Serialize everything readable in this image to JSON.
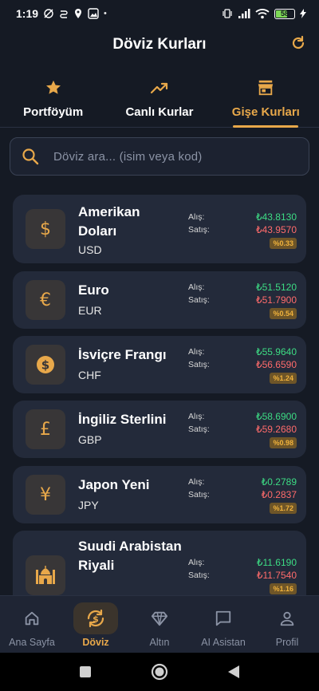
{
  "status_bar": {
    "time": "1:19",
    "battery": "58",
    "dot": "•"
  },
  "header": {
    "title": "Döviz Kurları"
  },
  "tabs": [
    {
      "label": "Portföyüm",
      "icon": "star-icon",
      "active": false
    },
    {
      "label": "Canlı Kurlar",
      "icon": "trending-up-icon",
      "active": false
    },
    {
      "label": "Gişe Kurları",
      "icon": "store-icon",
      "active": true
    }
  ],
  "search": {
    "placeholder": "Döviz ara... (isim veya kod)"
  },
  "labels": {
    "buy": "Alış:",
    "sell": "Satış:"
  },
  "currencies": [
    {
      "name": "Amerikan Doları",
      "code": "USD",
      "buy": "₺43.8130",
      "sell": "₺43.9570",
      "change": "%0.33",
      "icon": "dollar-icon"
    },
    {
      "name": "Euro",
      "code": "EUR",
      "buy": "₺51.5120",
      "sell": "₺51.7900",
      "change": "%0.54",
      "icon": "euro-icon"
    },
    {
      "name": "İsviçre Frangı",
      "code": "CHF",
      "buy": "₺55.9640",
      "sell": "₺56.6590",
      "change": "%1.24",
      "icon": "coin-icon"
    },
    {
      "name": "İngiliz Sterlini",
      "code": "GBP",
      "buy": "₺58.6900",
      "sell": "₺59.2680",
      "change": "%0.98",
      "icon": "pound-icon"
    },
    {
      "name": "Japon Yeni",
      "code": "JPY",
      "buy": "₺0.2789",
      "sell": "₺0.2837",
      "change": "%1.72",
      "icon": "yen-icon"
    },
    {
      "name": "Suudi Arabistan Riyali",
      "code": "SAR",
      "buy": "₺11.6190",
      "sell": "₺11.7540",
      "change": "%1.16",
      "icon": "mosque-icon"
    }
  ],
  "bottom_nav": [
    {
      "label": "Ana Sayfa",
      "icon": "home-icon",
      "active": false
    },
    {
      "label": "Döviz",
      "icon": "currency-exchange-icon",
      "active": true
    },
    {
      "label": "Altın",
      "icon": "diamond-icon",
      "active": false
    },
    {
      "label": "AI Asistan",
      "icon": "chat-icon",
      "active": false
    },
    {
      "label": "Profil",
      "icon": "user-icon",
      "active": false
    }
  ],
  "colors": {
    "background": "#151a24",
    "card": "#232a3a",
    "accent": "#e8a84a",
    "buy": "#3ddc84",
    "sell": "#ff6b6b"
  }
}
